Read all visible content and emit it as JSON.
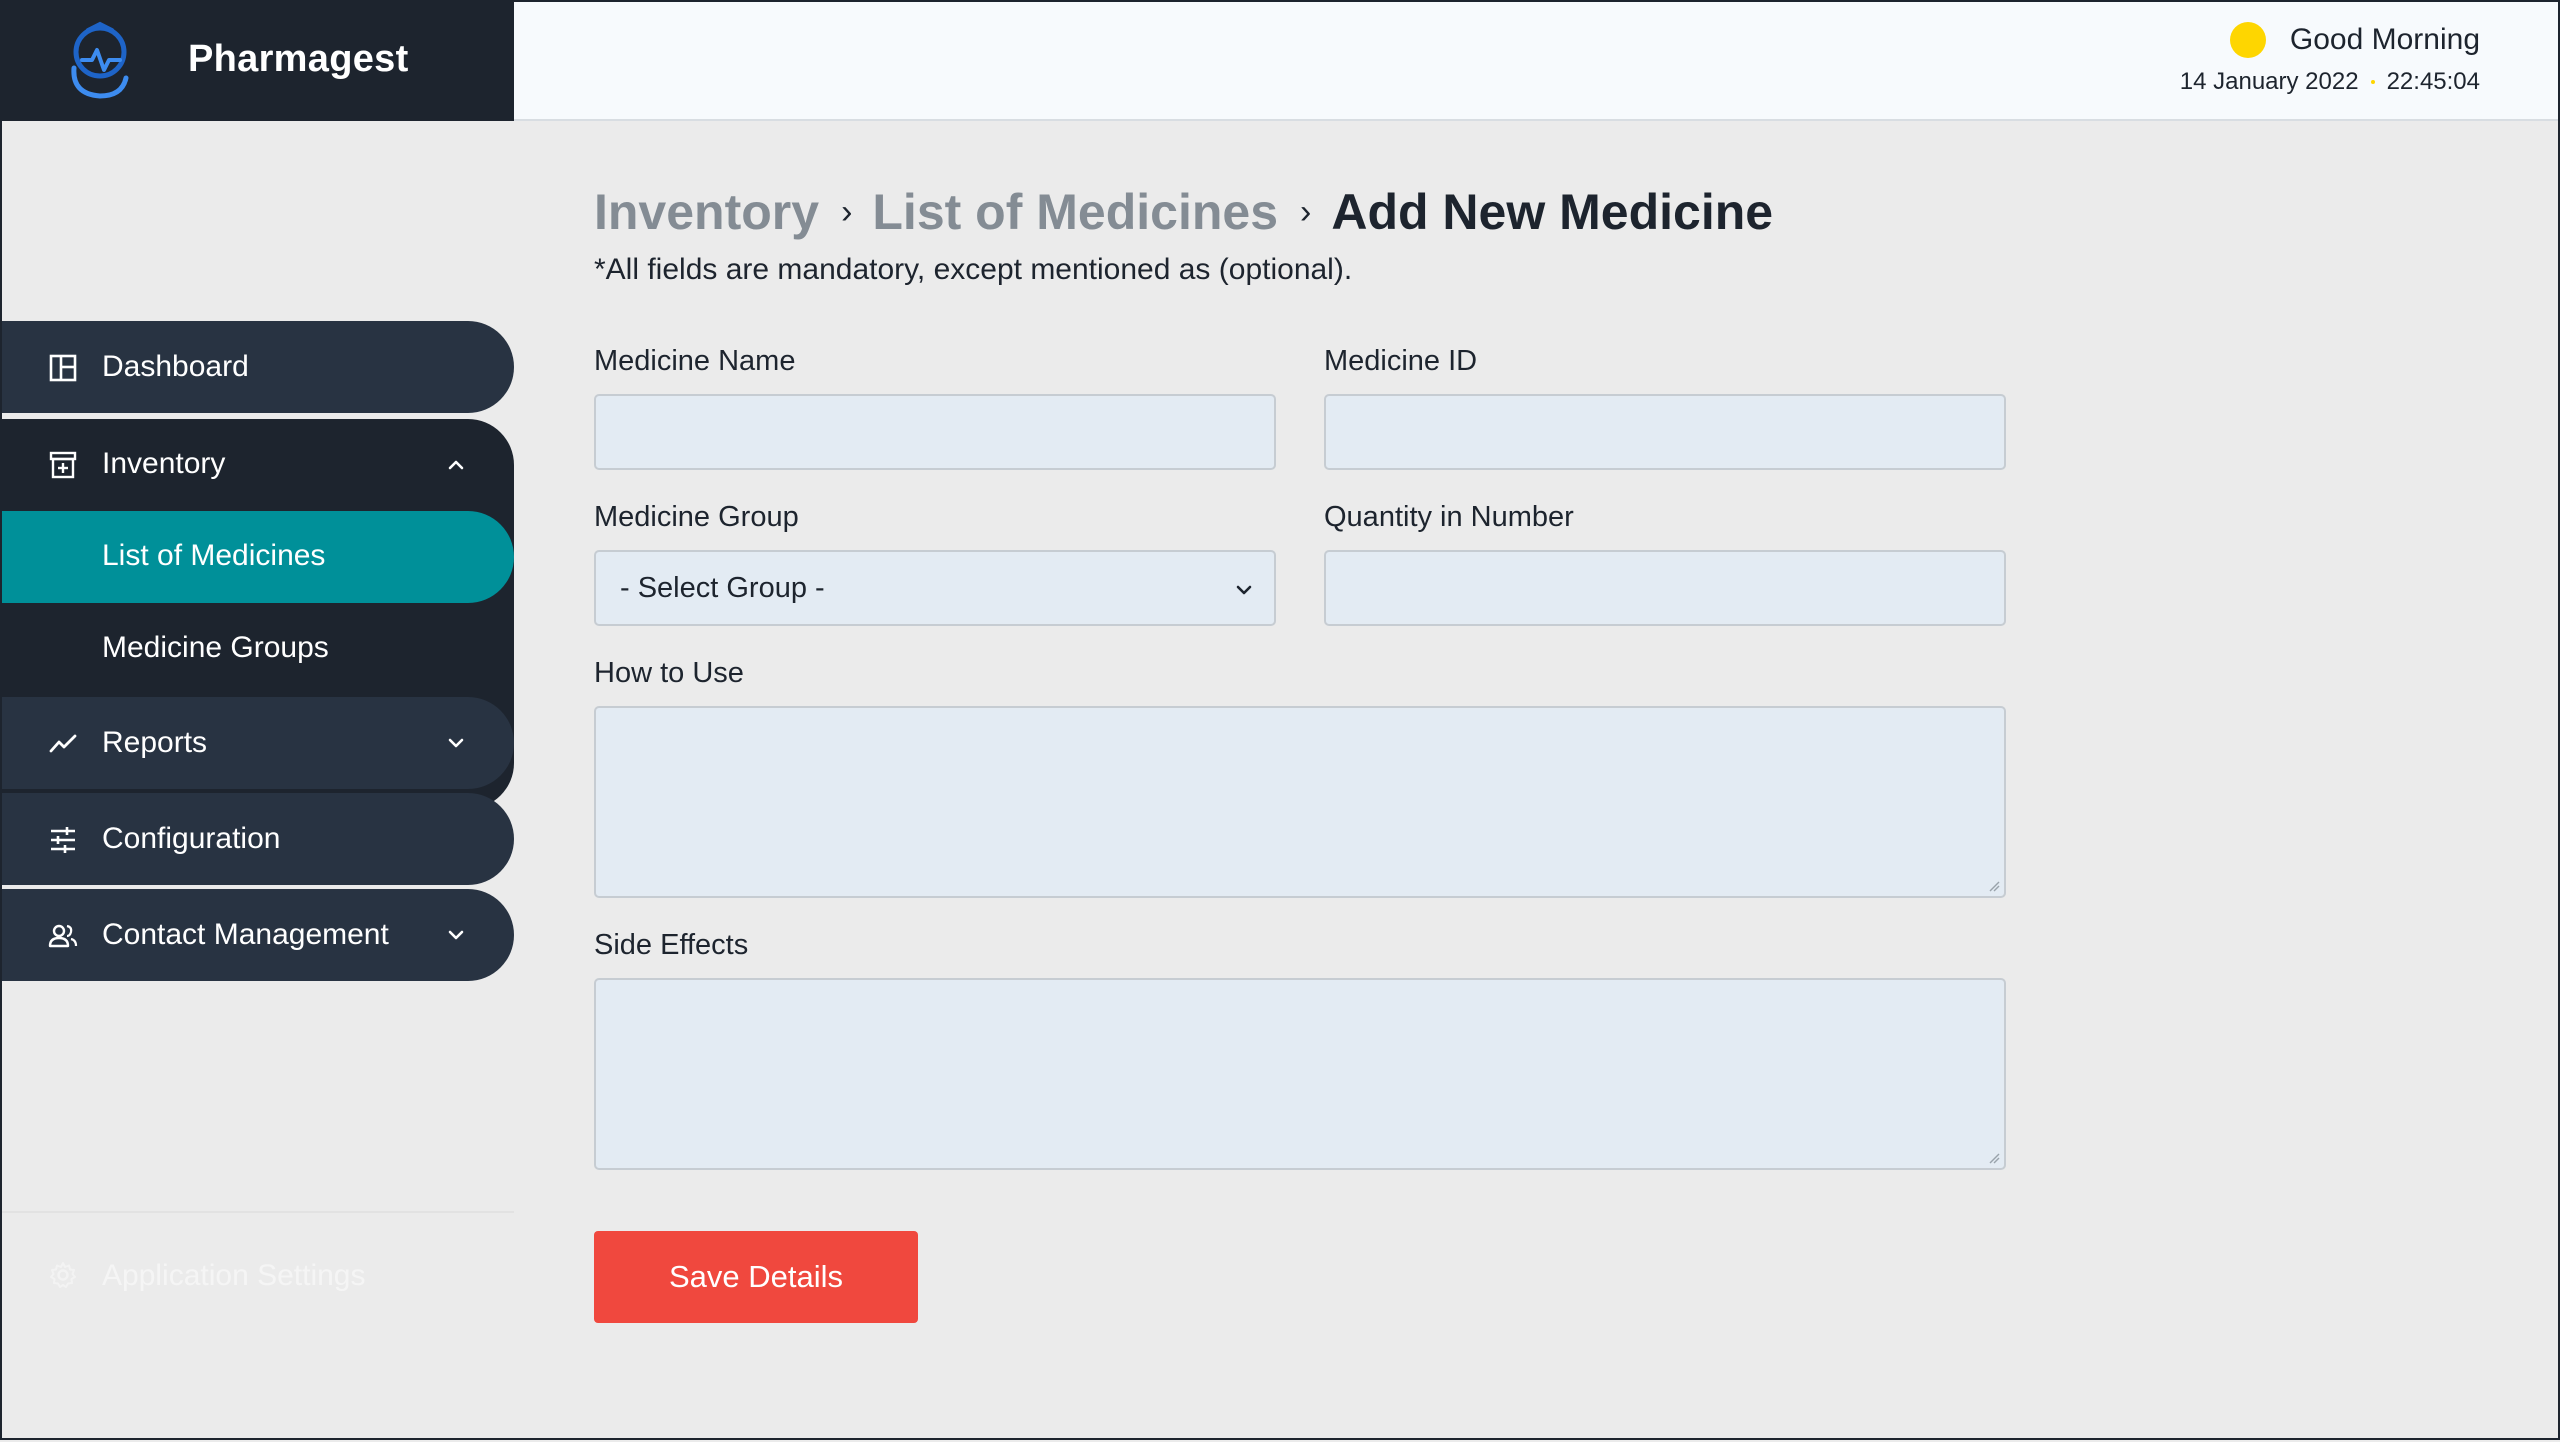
{
  "app": {
    "name": "Pharmagest"
  },
  "header": {
    "greeting": "Good Morning",
    "date": "14 January 2022",
    "time": "22:45:04"
  },
  "sidebar": {
    "items": [
      {
        "label": "Dashboard",
        "icon": "dashboard-icon"
      },
      {
        "label": "Inventory",
        "icon": "inventory-icon",
        "expanded": true,
        "children": [
          {
            "label": "List of Medicines",
            "active": true
          },
          {
            "label": "Medicine Groups",
            "active": false
          }
        ]
      },
      {
        "label": "Reports",
        "icon": "reports-icon"
      },
      {
        "label": "Configuration",
        "icon": "configuration-icon"
      },
      {
        "label": "Contact Management",
        "icon": "contact-management-icon"
      }
    ],
    "footer": {
      "label": "Application Settings",
      "icon": "gear-icon"
    }
  },
  "breadcrumb": {
    "level1": "Inventory",
    "level2": "List of Medicines",
    "current": "Add New Medicine",
    "separator": "›"
  },
  "form": {
    "note": "*All fields are mandatory, except mentioned as (optional).",
    "medicine_name": {
      "label": "Medicine Name",
      "value": ""
    },
    "medicine_id": {
      "label": "Medicine ID",
      "value": ""
    },
    "medicine_group": {
      "label": "Medicine Group",
      "value": "- Select Group -"
    },
    "quantity": {
      "label": "Quantity in Number",
      "value": ""
    },
    "how_to_use": {
      "label": "How to Use",
      "value": ""
    },
    "side_effects": {
      "label": "Side Effects",
      "value": ""
    },
    "save_label": "Save Details"
  },
  "colors": {
    "sidebar_bg": "#283342",
    "sidebar_dark": "#1d242e",
    "active": "#009099",
    "accent_button": "#f0483e",
    "sun": "#fed600",
    "input_bg": "#e3ebf3"
  }
}
